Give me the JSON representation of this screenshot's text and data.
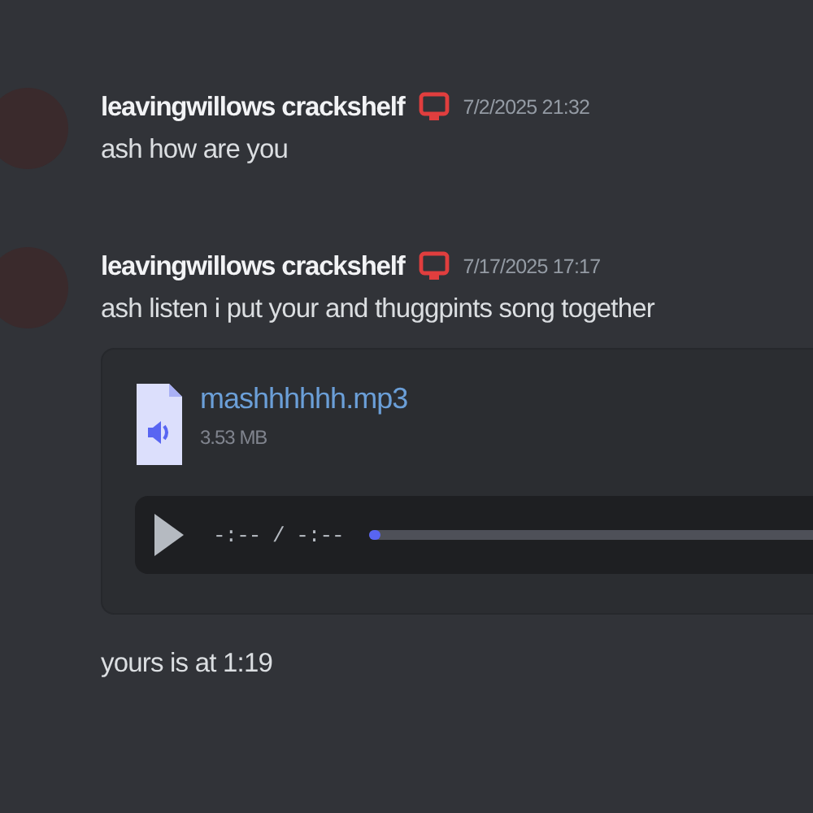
{
  "messages": [
    {
      "author": "leavingwillows crackshelf",
      "timestamp": "7/2/2025 21:32",
      "text": "ash how are you"
    },
    {
      "author": "leavingwillows crackshelf",
      "timestamp": "7/17/2025 17:17",
      "text": "ash listen i put your and thuggpints song together",
      "attachment": {
        "filename": "mashhhhhh.mp3",
        "size": "3.53 MB",
        "player": {
          "time": "-:-- / -:--",
          "level": 0
        }
      },
      "followup": "yours is at 1:19"
    }
  ]
}
